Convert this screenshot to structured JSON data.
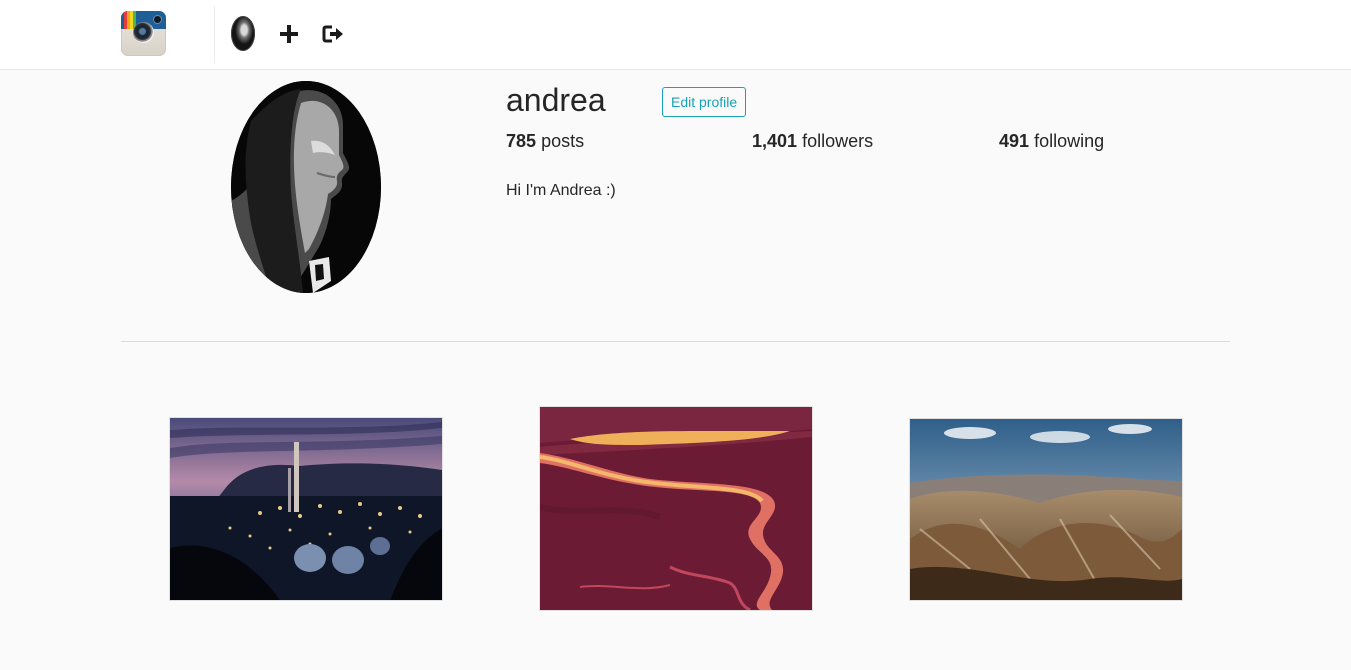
{
  "navbar": {
    "logo_icon": "camera-logo-icon",
    "avatar_icon": "user-avatar-icon",
    "add_icon": "plus-icon",
    "logout_icon": "sign-out-icon"
  },
  "profile": {
    "username": "andrea",
    "edit_button_label": "Edit profile",
    "stats": {
      "posts_count": "785",
      "posts_label": "posts",
      "followers_count": "1,401",
      "followers_label": "followers",
      "following_count": "491",
      "following_label": "following"
    },
    "bio": "Hi I'm Andrea :)"
  },
  "colors": {
    "accent": "#17a2b8",
    "background": "#fafafa",
    "text": "#262626"
  },
  "posts": [
    {
      "thumbnail": "industrial-night-photo"
    },
    {
      "thumbnail": "red-river-aerial-photo"
    },
    {
      "thumbnail": "mountain-landscape-photo"
    }
  ]
}
